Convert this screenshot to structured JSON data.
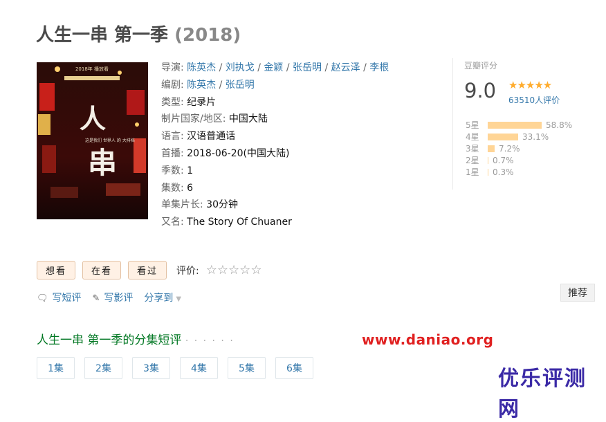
{
  "header": {
    "title": "人生一串 第一季",
    "year": "(2018)"
  },
  "poster": {
    "top_text": "2018年 播放看",
    "calligraphy": "人生一串",
    "tagline": "这是我们 世界人 的 大排档"
  },
  "info": {
    "director_label": "导演:",
    "directors": [
      "陈英杰",
      "刘执戈",
      "金颖",
      "张岳明",
      "赵云泽",
      "李根"
    ],
    "writer_label": "编剧:",
    "writers": [
      "陈英杰",
      "张岳明"
    ],
    "genre_label": "类型:",
    "genre": "纪录片",
    "country_label": "制片国家/地区:",
    "country": "中国大陆",
    "language_label": "语言:",
    "language": "汉语普通话",
    "premiere_label": "首播:",
    "premiere": "2018-06-20(中国大陆)",
    "seasons_label": "季数:",
    "seasons": "1",
    "episodes_label": "集数:",
    "episodes": "6",
    "runtime_label": "单集片长:",
    "runtime": "30分钟",
    "aka_label": "又名:",
    "aka": "The Story Of Chuaner",
    "sep": " / "
  },
  "rating": {
    "title": "豆瓣评分",
    "score": "9.0",
    "stars": "★★★★★",
    "votes": "63510人评价",
    "distribution": [
      {
        "label": "5星",
        "percent": "58.8%",
        "value": 58.8
      },
      {
        "label": "4星",
        "percent": "33.1%",
        "value": 33.1
      },
      {
        "label": "3星",
        "percent": "7.2%",
        "value": 7.2
      },
      {
        "label": "2星",
        "percent": "0.7%",
        "value": 0.7
      },
      {
        "label": "1星",
        "percent": "0.3%",
        "value": 0.3
      }
    ]
  },
  "actions": {
    "want": "想看",
    "watching": "在看",
    "watched": "看过",
    "rate_label": "评价:",
    "rate_stars": "☆☆☆☆☆"
  },
  "links": {
    "short_review": "写短评",
    "review": "写影评",
    "share": "分享到",
    "share_arrow": "▼"
  },
  "recommend": "推荐",
  "episode_section": {
    "title": "人生一串 第一季的分集短评",
    "dots": "· · · · · ·",
    "episodes": [
      "1集",
      "2集",
      "3集",
      "4集",
      "5集",
      "6集"
    ]
  },
  "watermarks": {
    "site": "www.daniao.org",
    "brand": "优乐评测网"
  },
  "colors": {
    "link": "#3377aa",
    "star": "#ffac2d",
    "bar": "#ffd596",
    "section": "#007722"
  }
}
